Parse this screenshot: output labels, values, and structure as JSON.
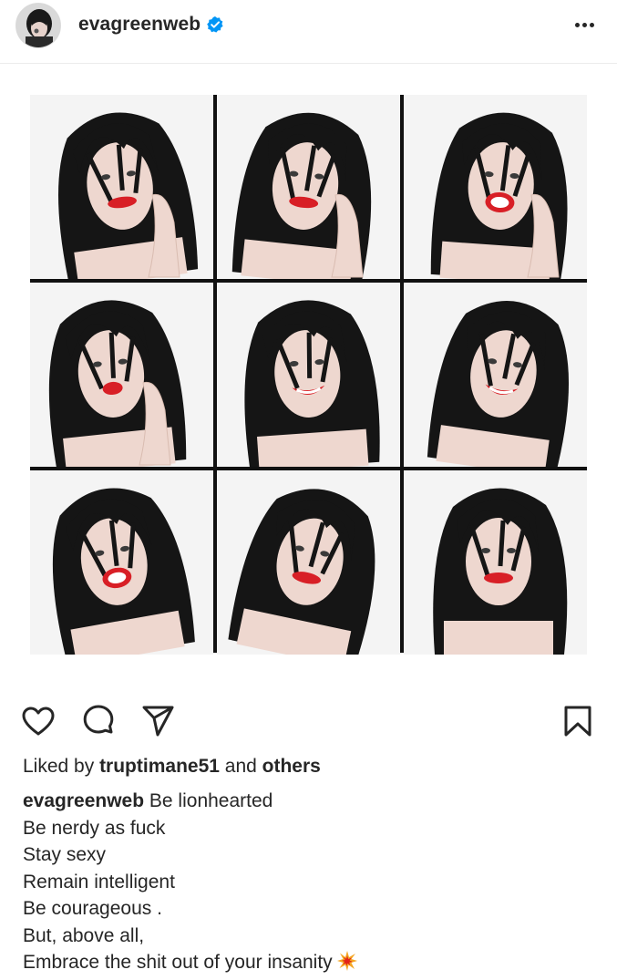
{
  "header": {
    "username": "evagreenweb",
    "verified": true,
    "avatar_icon": "profile-photo",
    "more_icon": "more-horizontal-icon"
  },
  "post": {
    "image_description_icons": [
      "photo-tile"
    ],
    "grid": {
      "rows": 3,
      "cols": 3
    }
  },
  "actions": {
    "like_icon": "heart-icon",
    "comment_icon": "comment-icon",
    "share_icon": "share-icon",
    "save_icon": "bookmark-icon"
  },
  "likes": {
    "prefix": "Liked by ",
    "user": "truptimane51",
    "middle": " and ",
    "others": "others"
  },
  "caption": {
    "username": "evagreenweb",
    "first_line": " Be lionhearted",
    "lines": [
      "Be nerdy as fuck",
      "Stay sexy",
      "Remain intelligent",
      "Be courageous .",
      "But, above all,",
      "Embrace the shit out of your insanity"
    ],
    "emoji": "collision-emoji"
  },
  "colors": {
    "text": "#262626",
    "verified_blue": "#0095f6",
    "lipstick_red": "#d81f26",
    "hair": "#151515",
    "skin": "#eed7cf",
    "divider": "#ececec"
  }
}
